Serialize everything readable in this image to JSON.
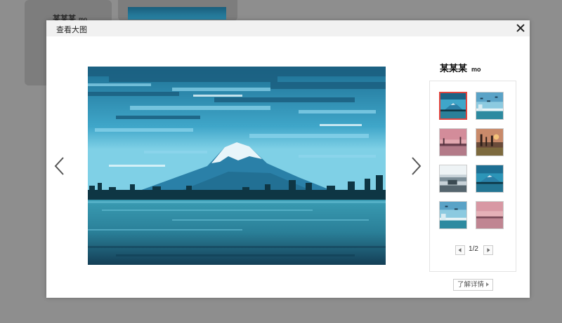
{
  "background": {
    "card_title": "某某某",
    "card_suffix": "mo"
  },
  "modal": {
    "title": "查看大图",
    "close_icon": "close-icon",
    "prev_icon": "chevron-left-icon",
    "next_icon": "chevron-right-icon",
    "author_name": "某某某",
    "author_suffix": "mo",
    "thumbnails": [
      {
        "theme": "mountain-lake",
        "active": true
      },
      {
        "theme": "seaside-birds",
        "active": false
      },
      {
        "theme": "pink-lake",
        "active": false
      },
      {
        "theme": "sunset-trees",
        "active": false
      },
      {
        "theme": "road-car",
        "active": false
      },
      {
        "theme": "mountain-lake",
        "active": false
      },
      {
        "theme": "seaside-birds",
        "active": false
      },
      {
        "theme": "pink-lake",
        "active": false
      }
    ],
    "pager": {
      "current": "1/2",
      "prev_icon": "caret-left-icon",
      "next_icon": "caret-right-icon"
    },
    "details_label": "了解详情",
    "details_icon": "caret-right-icon"
  },
  "colors": {
    "overlay": "#8e8e8e",
    "active_border": "#e0453f",
    "header_bg": "#f1f1f1"
  }
}
